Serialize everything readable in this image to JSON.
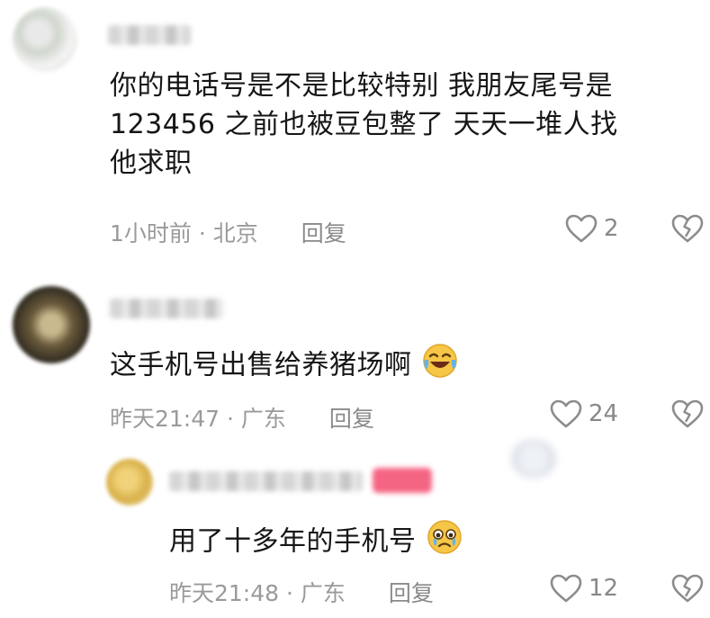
{
  "comments": [
    {
      "text_lines": [
        "你的电话号是不是比较特别 我朋友尾号是",
        "123456 之前也被豆包整了 天天一堆人找",
        "他求职"
      ],
      "time": "1小时前",
      "location": "北京",
      "reply_label": "回复",
      "likes": "2"
    },
    {
      "text": "这手机号出售给养猪场啊",
      "time": "昨天21:47",
      "location": "广东",
      "reply_label": "回复",
      "likes": "24",
      "emoji": "laughing-crying-emoji"
    },
    {
      "text": "用了十多年的手机号",
      "time": "昨天21:48",
      "location": "广东",
      "reply_label": "回复",
      "likes": "12",
      "emoji": "teary-face-emoji",
      "is_reply": true
    }
  ],
  "colors": {
    "text": "#161616",
    "meta": "#9a9a9a",
    "icon": "#8c8c8c",
    "badge": "#f1315a"
  }
}
